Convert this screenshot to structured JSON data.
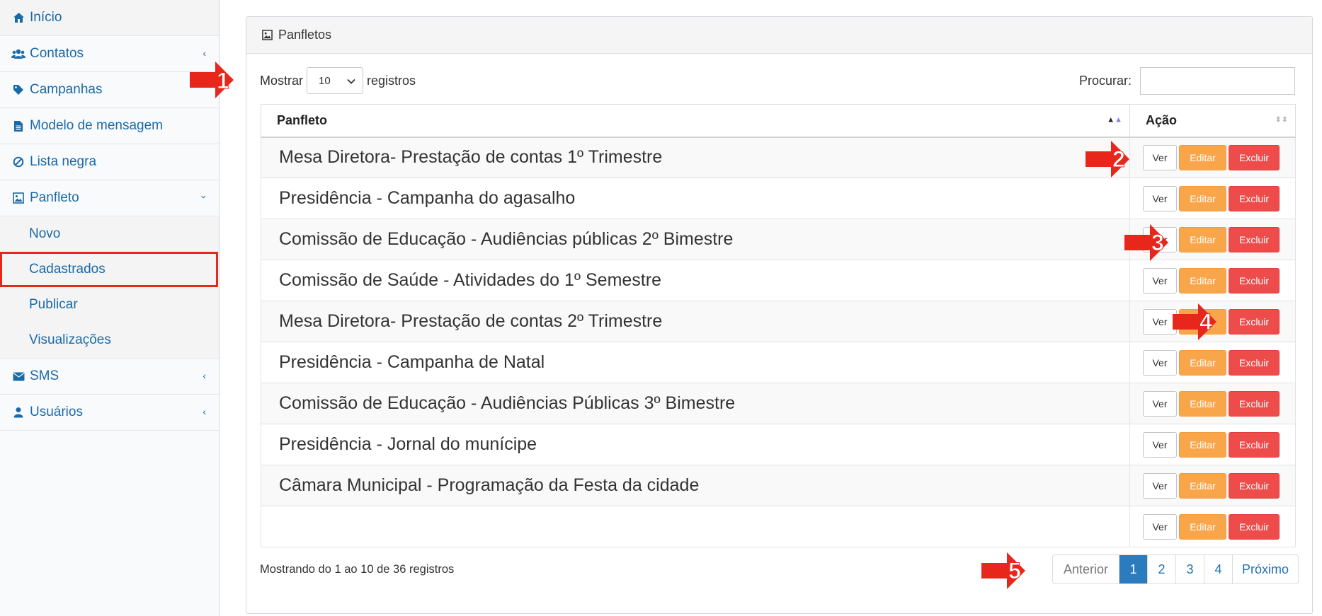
{
  "sidebar": {
    "items": [
      {
        "label": "Início",
        "icon": "home-icon"
      },
      {
        "label": "Contatos",
        "icon": "users-icon"
      },
      {
        "label": "Campanhas",
        "icon": "tag-icon"
      },
      {
        "label": "Modelo de mensagem",
        "icon": "file-icon"
      },
      {
        "label": "Lista negra",
        "icon": "ban-icon"
      },
      {
        "label": "Panfleto",
        "icon": "image-icon"
      },
      {
        "label": "SMS",
        "icon": "envelope-icon"
      },
      {
        "label": "Usuários",
        "icon": "user-icon"
      }
    ],
    "submenu": [
      "Novo",
      "Cadastrados",
      "Publicar",
      "Visualizações"
    ],
    "highlighted_sub": "Cadastrados"
  },
  "panel": {
    "title": "Panfletos"
  },
  "controls": {
    "show_label": "Mostrar",
    "page_size": "10",
    "records_label": "registros",
    "search_label": "Procurar:"
  },
  "table": {
    "columns": [
      "Panfleto",
      "Ação"
    ],
    "rows": [
      "Mesa Diretora- Prestação de contas 1º Trimestre",
      "Presidência - Campanha do agasalho",
      "Comissão de Educação - Audiências públicas 2º Bimestre",
      "Comissão de Saúde - Atividades do 1º Semestre",
      "Mesa Diretora- Prestação de contas 2º Trimestre",
      "Presidência - Campanha de Natal",
      "Comissão de Educação - Audiências Públicas 3º Bimestre",
      "Presidência - Jornal do munícipe",
      "Câmara Municipal - Programação da Festa da cidade",
      ""
    ],
    "actions": {
      "view": "Ver",
      "edit": "Editar",
      "delete": "Excluir"
    }
  },
  "footer": {
    "info": "Mostrando do 1 ao 10 de 36 registros",
    "pagination": {
      "prev": "Anterior",
      "pages": [
        "1",
        "2",
        "3",
        "4"
      ],
      "current": "1",
      "next": "Próximo"
    }
  },
  "annotations": [
    "1",
    "2",
    "3",
    "4",
    "5"
  ],
  "colors": {
    "link": "#1a6aa8",
    "edit": "#f9a64a",
    "delete": "#ee4b4b",
    "active_page": "#2b7bbf",
    "annotation_arrow": "#e8271c"
  }
}
